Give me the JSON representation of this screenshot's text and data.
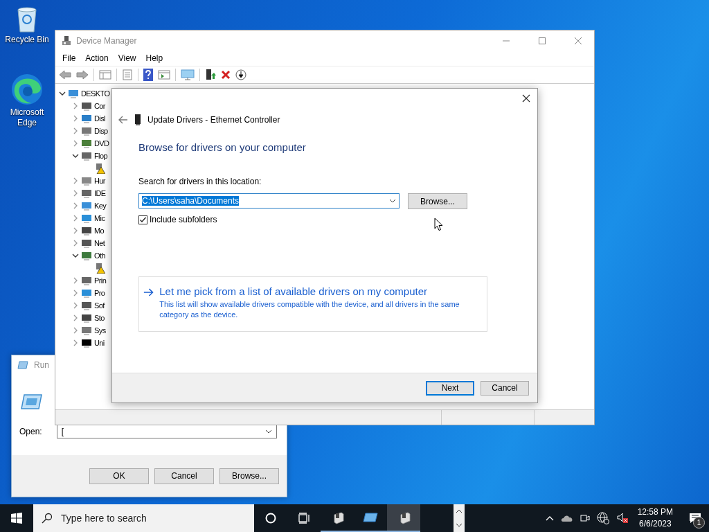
{
  "desktop_icons": [
    {
      "label": "Recycle Bin"
    },
    {
      "label": "Microsoft Edge"
    }
  ],
  "device_manager": {
    "title": "Device Manager",
    "menu": [
      "File",
      "Action",
      "View",
      "Help"
    ],
    "tree": {
      "label": "DESKTO",
      "expanded": true,
      "children": [
        {
          "label": "Cor",
          "expanded": false
        },
        {
          "label": "Disl",
          "expanded": false
        },
        {
          "label": "Disp",
          "expanded": false
        },
        {
          "label": "DVD",
          "expanded": false
        },
        {
          "label": "Flop",
          "expanded": true,
          "children": [
            {
              "warning": true
            }
          ]
        },
        {
          "label": "Hur",
          "expanded": false
        },
        {
          "label": "IDE",
          "expanded": false
        },
        {
          "label": "Key",
          "expanded": false
        },
        {
          "label": "Mic",
          "expanded": false
        },
        {
          "label": "Mo",
          "expanded": false
        },
        {
          "label": "Net",
          "expanded": false
        },
        {
          "label": "Oth",
          "expanded": true,
          "children": [
            {
              "warning": true
            }
          ]
        },
        {
          "label": "Prin",
          "expanded": false
        },
        {
          "label": "Pro",
          "expanded": false
        },
        {
          "label": "Sof",
          "expanded": false
        },
        {
          "label": "Sto",
          "expanded": false
        },
        {
          "label": "Sys",
          "expanded": false
        },
        {
          "label": "Uni",
          "expanded": false
        }
      ]
    }
  },
  "update_dialog": {
    "title": "Update Drivers - Ethernet Controller",
    "heading": "Browse for drivers on your computer",
    "location_label": "Search for drivers in this location:",
    "location_value": "C:\\Users\\saha\\Documents",
    "value_selected": true,
    "browse_button": "Browse...",
    "include_subfolders": {
      "label": "Include subfolders",
      "checked": true
    },
    "pick_link": {
      "title": "Let me pick from a list of available drivers on my computer",
      "description": "This list will show available drivers compatible with the device, and all drivers in the same category as the device."
    },
    "buttons": [
      {
        "label": "Next",
        "default": true
      },
      {
        "label": "Cancel",
        "default": false
      }
    ]
  },
  "run_dialog": {
    "title": "Run",
    "open_label": "Open:",
    "open_value": "[",
    "buttons": [
      "OK",
      "Cancel",
      "Browse..."
    ]
  },
  "taskbar": {
    "search_placeholder": "Type here to search",
    "apps": [
      {
        "selected": false
      },
      {
        "selected": false
      },
      {
        "selected": true
      }
    ],
    "time": "12:58 PM",
    "date": "6/6/2023",
    "notification_count": "1"
  }
}
